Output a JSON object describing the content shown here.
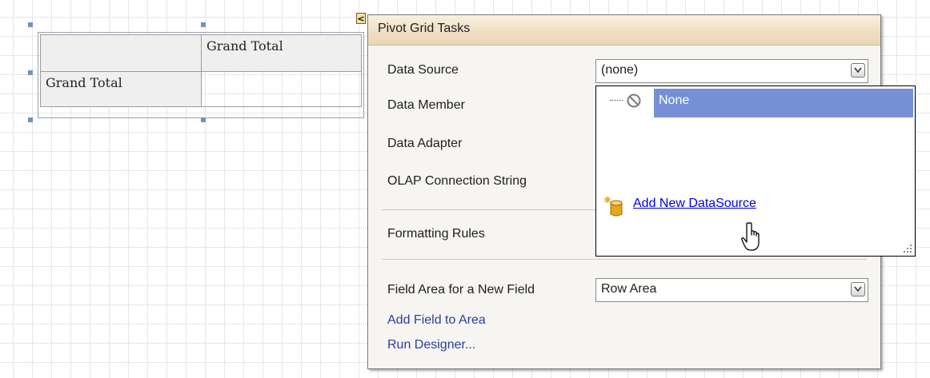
{
  "pivot_grid": {
    "column_header": "Grand Total",
    "row_header": "Grand Total"
  },
  "smart_tag": {
    "collapse_glyph": "<"
  },
  "panel": {
    "title": "Pivot Grid Tasks",
    "data_source": {
      "label": "Data Source",
      "value": "(none)"
    },
    "data_member": {
      "label": "Data Member"
    },
    "data_adapter": {
      "label": "Data Adapter"
    },
    "olap": {
      "label": "OLAP Connection String"
    },
    "formatting_rules": {
      "label": "Formatting Rules"
    },
    "field_area": {
      "label": "Field Area for a New Field",
      "value": "Row Area"
    },
    "actions": {
      "add_field": "Add Field to Area",
      "run_designer": "Run Designer..."
    }
  },
  "dropdown": {
    "selected_item": "None",
    "add_new": "Add New DataSource"
  },
  "colors": {
    "selection": "#7590d5",
    "link": "#0000dd",
    "task_link": "#2a3f9a",
    "panel_header": "#e8d5b3"
  },
  "icons": [
    "chevron-down-icon",
    "none-icon",
    "database-add-icon",
    "hand-cursor-icon",
    "resize-grip-icon"
  ]
}
